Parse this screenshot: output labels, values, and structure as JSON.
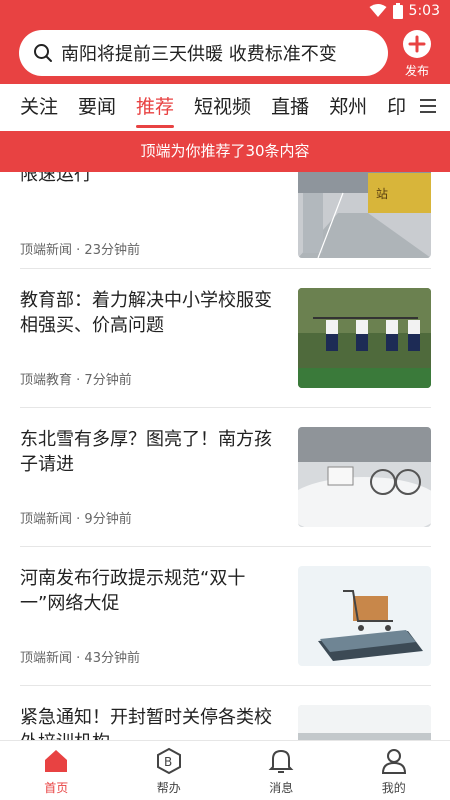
{
  "status_bar": {
    "time": "5:03"
  },
  "search": {
    "text": "南阳将提前三天供暖 收费标准不变"
  },
  "publish": {
    "label": "发布"
  },
  "tabs": [
    {
      "label": "关注"
    },
    {
      "label": "要闻"
    },
    {
      "label": "推荐",
      "active": true
    },
    {
      "label": "短视频"
    },
    {
      "label": "直播"
    },
    {
      "label": "郑州"
    },
    {
      "label": "印"
    }
  ],
  "banner": {
    "text": "顶端为你推荐了30条内容"
  },
  "articles": [
    {
      "title": "首次启用全新管控策略 部分时段限速运行",
      "source": "顶端新闻",
      "time": "23分钟前",
      "thumb": "subway-station-photo"
    },
    {
      "title": "教育部：着力解决中小学校服变相强买、价高问题",
      "source": "顶端教育",
      "time": "7分钟前",
      "thumb": "students-in-uniform-photo"
    },
    {
      "title": "东北雪有多厚？图亮了！南方孩子请进",
      "source": "顶端新闻",
      "time": "9分钟前",
      "thumb": "snow-covered-bikes-photo"
    },
    {
      "title": "河南发布行政提示规范“双十一”网络大促",
      "source": "顶端新闻",
      "time": "43分钟前",
      "thumb": "shopping-cart-laptop-photo"
    },
    {
      "title": "紧急通知！开封暂时关停各类校外培训机构",
      "source": "",
      "time": "",
      "thumb": "classroom-photo"
    }
  ],
  "bottom_nav": [
    {
      "label": "首页",
      "icon": "home-icon",
      "active": true
    },
    {
      "label": "帮办",
      "icon": "badge-icon"
    },
    {
      "label": "消息",
      "icon": "bell-icon"
    },
    {
      "label": "我的",
      "icon": "user-icon"
    }
  ],
  "colors": {
    "accent": "#e84242"
  }
}
